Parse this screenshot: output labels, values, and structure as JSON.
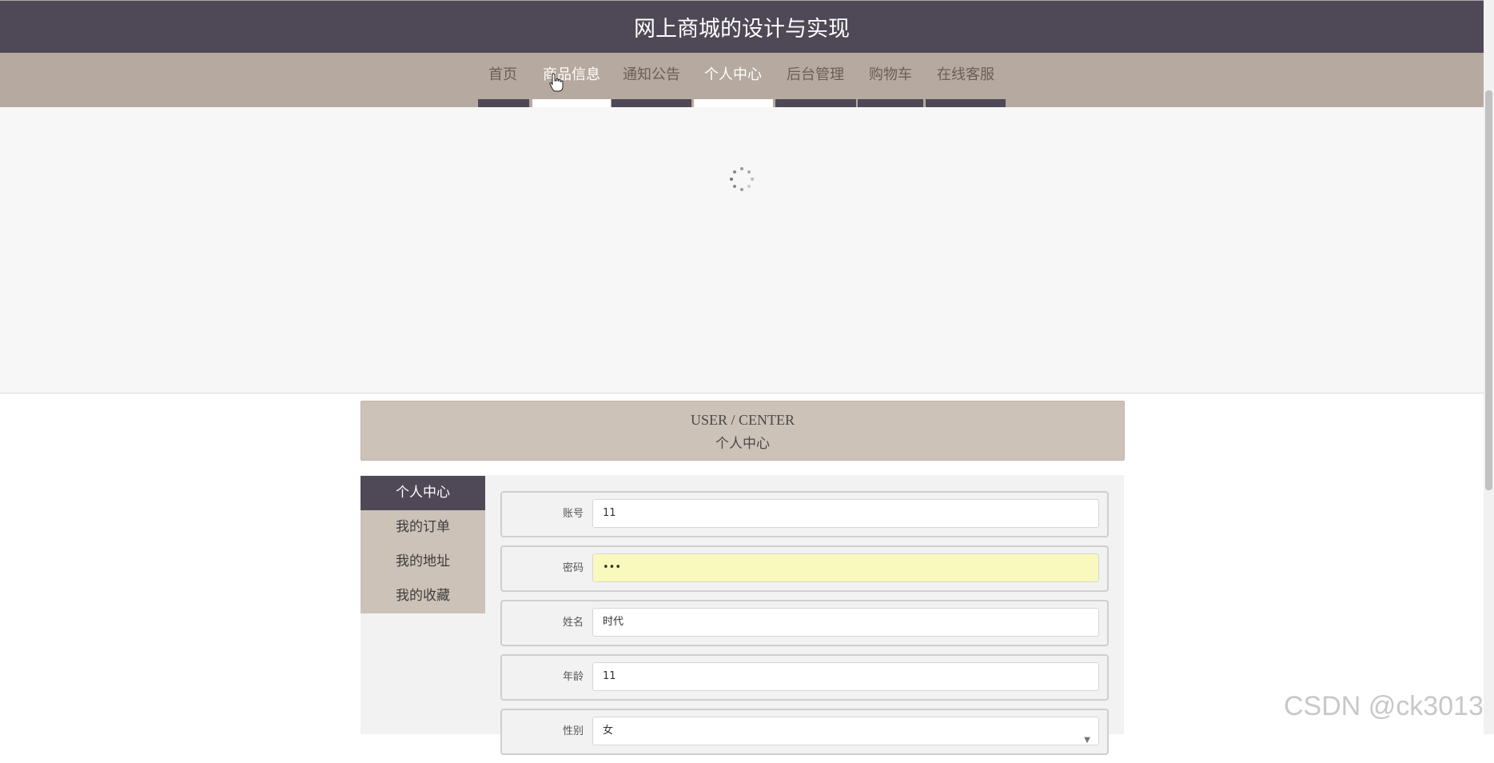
{
  "header": {
    "title": "网上商城的设计与实现"
  },
  "nav": {
    "items": [
      {
        "label": "首页"
      },
      {
        "label": "商品信息"
      },
      {
        "label": "通知公告"
      },
      {
        "label": "个人中心"
      },
      {
        "label": "后台管理"
      },
      {
        "label": "购物车"
      },
      {
        "label": "在线客服"
      }
    ],
    "active": "个人中心"
  },
  "section_title": {
    "en": "USER / CENTER",
    "cn": "个人中心"
  },
  "sidebar": {
    "items": [
      {
        "label": "个人中心"
      },
      {
        "label": "我的订单"
      },
      {
        "label": "我的地址"
      },
      {
        "label": "我的收藏"
      }
    ]
  },
  "form": {
    "fields": [
      {
        "label": "账号",
        "value": "11"
      },
      {
        "label": "密码",
        "value": "•••"
      },
      {
        "label": "姓名",
        "value": "时代"
      },
      {
        "label": "年龄",
        "value": "11"
      },
      {
        "label": "性别",
        "value": "女"
      }
    ]
  },
  "watermark": "CSDN @ck3013",
  "colors": {
    "header_bg": "#4f4856",
    "nav_bg": "#b6a99f",
    "accent_bg": "#cdc2b8",
    "autofill_bg": "#faf9bd"
  }
}
